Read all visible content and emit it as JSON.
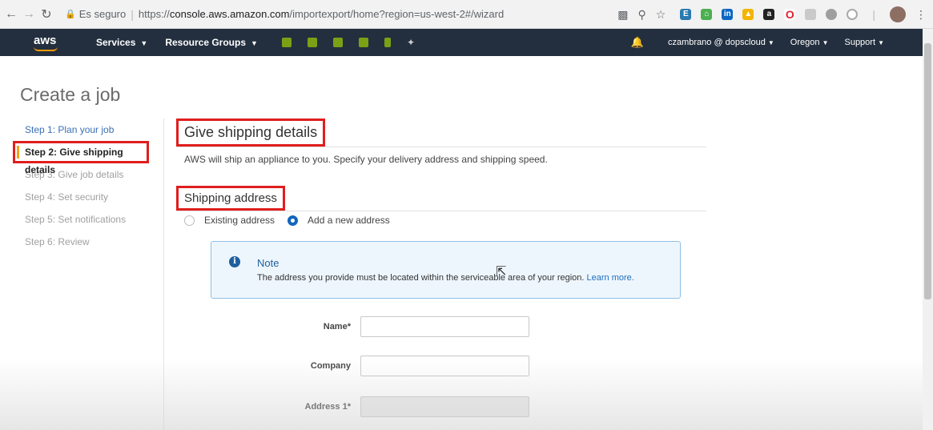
{
  "browser": {
    "back_icon": "arrow-left-icon",
    "forward_icon": "arrow-right-icon",
    "reload_icon": "reload-icon",
    "secure_label": "Es seguro",
    "url_scheme": "https://",
    "url_host": "console.aws.amazon.com",
    "url_path": "/importexport/home?region=us-west-2#/wizard",
    "extensions": [
      "translate-icon",
      "zoom-icon",
      "star-icon",
      "ext-e-icon",
      "ext-basket-icon",
      "linkedin-icon",
      "drive-triangle-icon",
      "amazon-ext-icon",
      "opera-icon",
      "ext-gray-icon",
      "cloud-icon",
      "circle-icon",
      "avatar-icon",
      "menu-dots-icon"
    ]
  },
  "aws_nav": {
    "logo": "aws",
    "services_label": "Services",
    "resource_groups_label": "Resource Groups",
    "account_label": "czambrano @ dopscloud",
    "region_label": "Oregon",
    "support_label": "Support",
    "accent_color": "#ff9900",
    "bg_color": "#232f3e"
  },
  "page": {
    "title": "Create a job"
  },
  "steps": [
    {
      "label": "Step 1: Plan your job",
      "state": "done"
    },
    {
      "label": "Step 2: Give shipping details",
      "state": "active"
    },
    {
      "label": "Step 3: Give job details",
      "state": "pending"
    },
    {
      "label": "Step 4: Set security",
      "state": "pending"
    },
    {
      "label": "Step 5: Set notifications",
      "state": "pending"
    },
    {
      "label": "Step 6: Review",
      "state": "pending"
    }
  ],
  "main": {
    "heading": "Give shipping details",
    "description": "AWS will ship an appliance to you. Specify your delivery address and shipping speed.",
    "address_heading": "Shipping address",
    "radio_existing": "Existing address",
    "radio_new": "Add a new address",
    "selected_option": "Add a new address"
  },
  "note": {
    "title": "Note",
    "body": "The address you provide must be located within the serviceable area of your region.",
    "link": "Learn more."
  },
  "form": {
    "name_label": "Name*",
    "name_value": "",
    "company_label": "Company",
    "company_value": "",
    "address1_label": "Address 1*",
    "address1_value": ""
  },
  "colors": {
    "highlight_box": "#e01e1e",
    "link": "#3a6fb5",
    "note_bg": "#eef6fd",
    "active_step_marker": "#f7a11a"
  }
}
